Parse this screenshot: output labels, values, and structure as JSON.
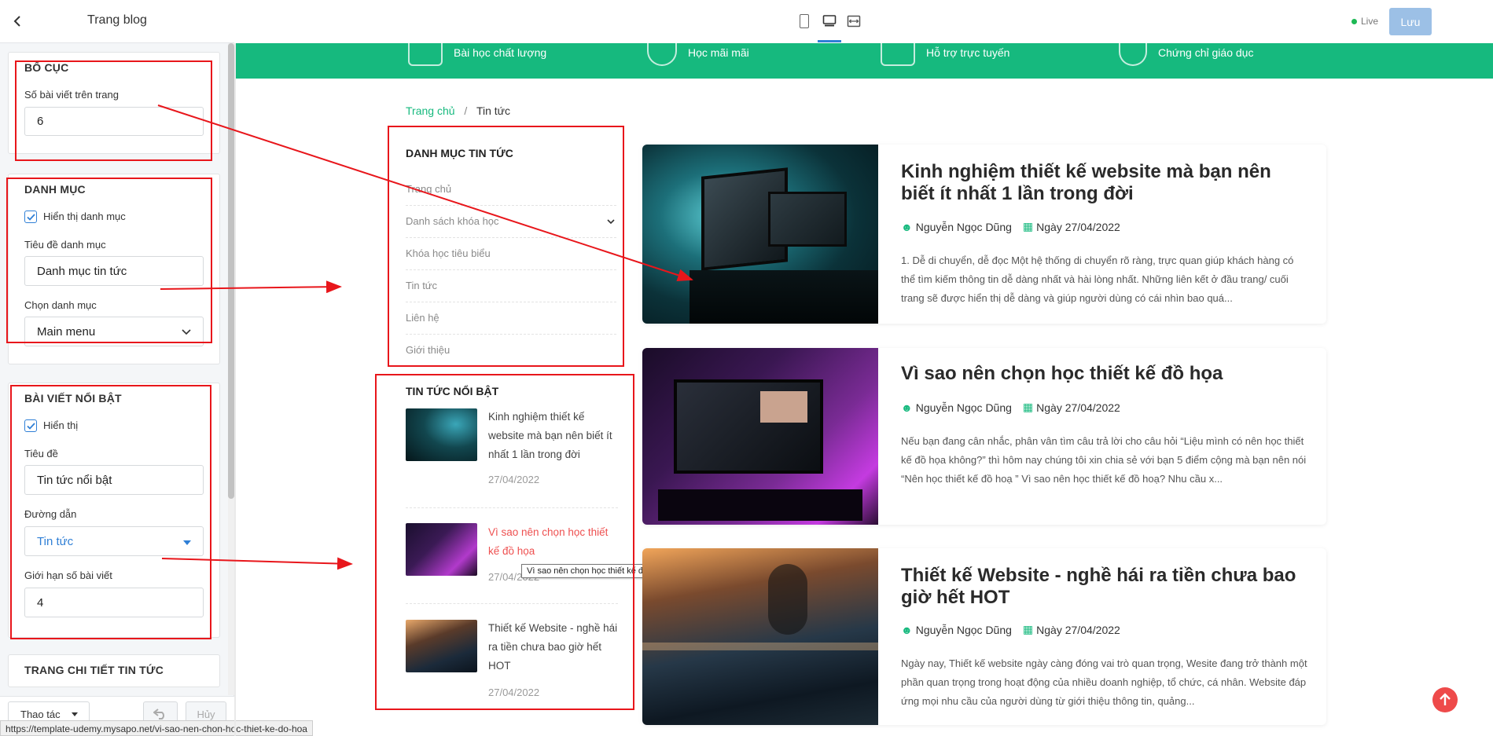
{
  "panel": {
    "title": "Trang blog",
    "layout": {
      "heading": "BỐ CỤC",
      "posts_per_page_label": "Số bài viết trên trang",
      "posts_per_page_value": "6"
    },
    "category": {
      "heading": "DANH MỤC",
      "show_label": "Hiển thị danh mục",
      "title_label": "Tiêu đề danh mục",
      "title_value": "Danh mục tin tức",
      "choose_label": "Chọn danh mục",
      "choose_value": "Main menu"
    },
    "featured": {
      "heading": "BÀI VIẾT NỔI BẬT",
      "show_label": "Hiển thị",
      "title_label": "Tiêu đề",
      "title_value": "Tin tức nổi bật",
      "link_label": "Đường dẫn",
      "link_value": "Tin tức",
      "limit_label": "Giới hạn số bài viết",
      "limit_value": "4"
    },
    "detail": {
      "heading": "TRANG CHI TIẾT TIN TỨC"
    },
    "actions_label": "Thao tác",
    "cancel_label": "Hủy"
  },
  "status_url": "https://template-udemy.mysapo.net/vi-sao-nen-chon-hoc-thiet-ke-do-hoa",
  "topbar": {
    "live_label": "Live",
    "save_label": "Lưu",
    "accent": "#16b97e"
  },
  "banner": [
    {
      "label": "Bài học chất lượng",
      "icon": "laptop-icon"
    },
    {
      "label": "Học mãi mãi",
      "icon": "eye-icon"
    },
    {
      "label": "Hỗ trợ trực tuyến",
      "icon": "monitor-icon"
    },
    {
      "label": "Chứng chỉ giáo dục",
      "icon": "certificate-icon"
    }
  ],
  "breadcrumb": {
    "home": "Trang chủ",
    "sep": "/",
    "current": "Tin tức"
  },
  "categories": {
    "heading": "DANH MỤC TIN TỨC",
    "items": [
      "Trang chủ",
      "Danh sách khóa học",
      "Khóa học tiêu biểu",
      "Tin tức",
      "Liên hệ",
      "Giới thiệu"
    ]
  },
  "featured_news": {
    "heading": "TIN TỨC NỔI BẬT",
    "items": [
      {
        "title": "Kinh nghiệm thiết kế website mà bạn nên biết ít nhất 1 lần trong đời",
        "date": "27/04/2022"
      },
      {
        "title": "Vì sao nên chọn học thiết kế đồ họa",
        "date": "27/04/2022"
      },
      {
        "title": "Thiết kế Website - nghề hái ra tiền chưa bao giờ hết HOT",
        "date": "27/04/2022"
      }
    ],
    "tooltip": "Vì sao nên chọn học thiết kế đồ họa"
  },
  "posts": [
    {
      "title": "Kinh nghiệm thiết kế website mà bạn nên biết ít nhất 1 lần trong đời",
      "author": "Nguyễn Ngọc Dũng",
      "date": "Ngày 27/04/2022",
      "excerpt": "1. Dễ di chuyển, dễ đọc Một hệ thống di chuyển rõ ràng, trực quan giúp khách hàng có thể tìm kiếm thông tin dễ dàng nhất và hài lòng nhất. Những liên kết ở đầu trang/ cuối trang sẽ được hiển thị dễ dàng và giúp người dùng có cái nhìn bao quá..."
    },
    {
      "title": "Vì sao nên chọn học thiết kế đồ họa",
      "author": "Nguyễn Ngọc Dũng",
      "date": "Ngày 27/04/2022",
      "excerpt": "Nếu bạn đang cân nhắc, phân vân tìm câu trả lời cho câu hỏi “Liệu mình có nên học thiết kế đồ họa không?” thì hôm nay chúng tôi xin chia sẻ với bạn 5 điểm cộng mà bạn nên nói “Nên học thiết kế đồ hoạ ” Vì sao nên học thiết kế đồ hoạ? Nhu cầu x..."
    },
    {
      "title": "Thiết kế Website - nghề hái ra tiền chưa bao giờ hết HOT",
      "author": "Nguyễn Ngọc Dũng",
      "date": "Ngày 27/04/2022",
      "excerpt": "Ngày nay, Thiết kế website ngày càng đóng vai trò quan trọng, Wesite đang trở thành một phần quan trọng trong hoạt động của nhiều doanh nghiệp, tổ chức, cá nhân. Website đáp ứng mọi nhu cầu của người dùng từ giới thiệu thông tin, quảng..."
    }
  ]
}
